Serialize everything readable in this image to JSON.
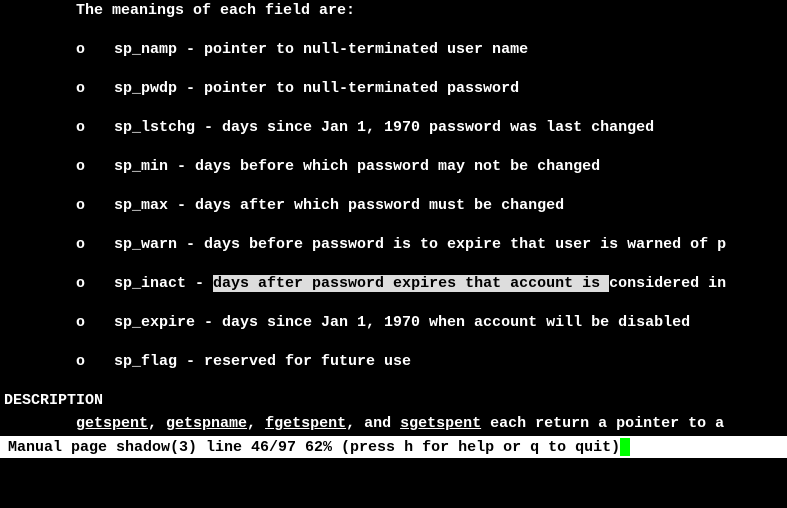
{
  "intro": "The meanings of each field are:",
  "bullets": [
    {
      "marker": "o",
      "prefix": "sp_namp - pointer to null-terminated user name",
      "highlight": "",
      "suffix": ""
    },
    {
      "marker": "o",
      "prefix": "sp_pwdp - pointer to null-terminated password",
      "highlight": "",
      "suffix": ""
    },
    {
      "marker": "o",
      "prefix": "sp_lstchg - days since Jan 1, 1970 password was last changed",
      "highlight": "",
      "suffix": ""
    },
    {
      "marker": "o",
      "prefix": "sp_min - days before which password may not be changed",
      "highlight": "",
      "suffix": ""
    },
    {
      "marker": "o",
      "prefix": "sp_max - days after which password must be changed",
      "highlight": "",
      "suffix": ""
    },
    {
      "marker": "o",
      "prefix": "sp_warn - days before password is to expire that user is warned of p",
      "highlight": "",
      "suffix": ""
    },
    {
      "marker": "o",
      "prefix": "sp_inact - ",
      "highlight": "days after password expires that account is ",
      "suffix": "considered in"
    },
    {
      "marker": "o",
      "prefix": "sp_expire - days since Jan 1, 1970 when account will be disabled",
      "highlight": "",
      "suffix": ""
    },
    {
      "marker": "o",
      "prefix": "sp_flag - reserved for future use",
      "highlight": "",
      "suffix": ""
    }
  ],
  "section_header": "DESCRIPTION",
  "desc": {
    "fn1": "getspent",
    "sep1": ", ",
    "fn2": "getspname",
    "sep2": ", ",
    "fn3": "fgetspent",
    "sep3": ", and ",
    "fn4": "sgetspent",
    "rest": " each return a pointer to a"
  },
  "status": "Manual page shadow(3) line 46/97 62% (press h for help or q to quit)"
}
